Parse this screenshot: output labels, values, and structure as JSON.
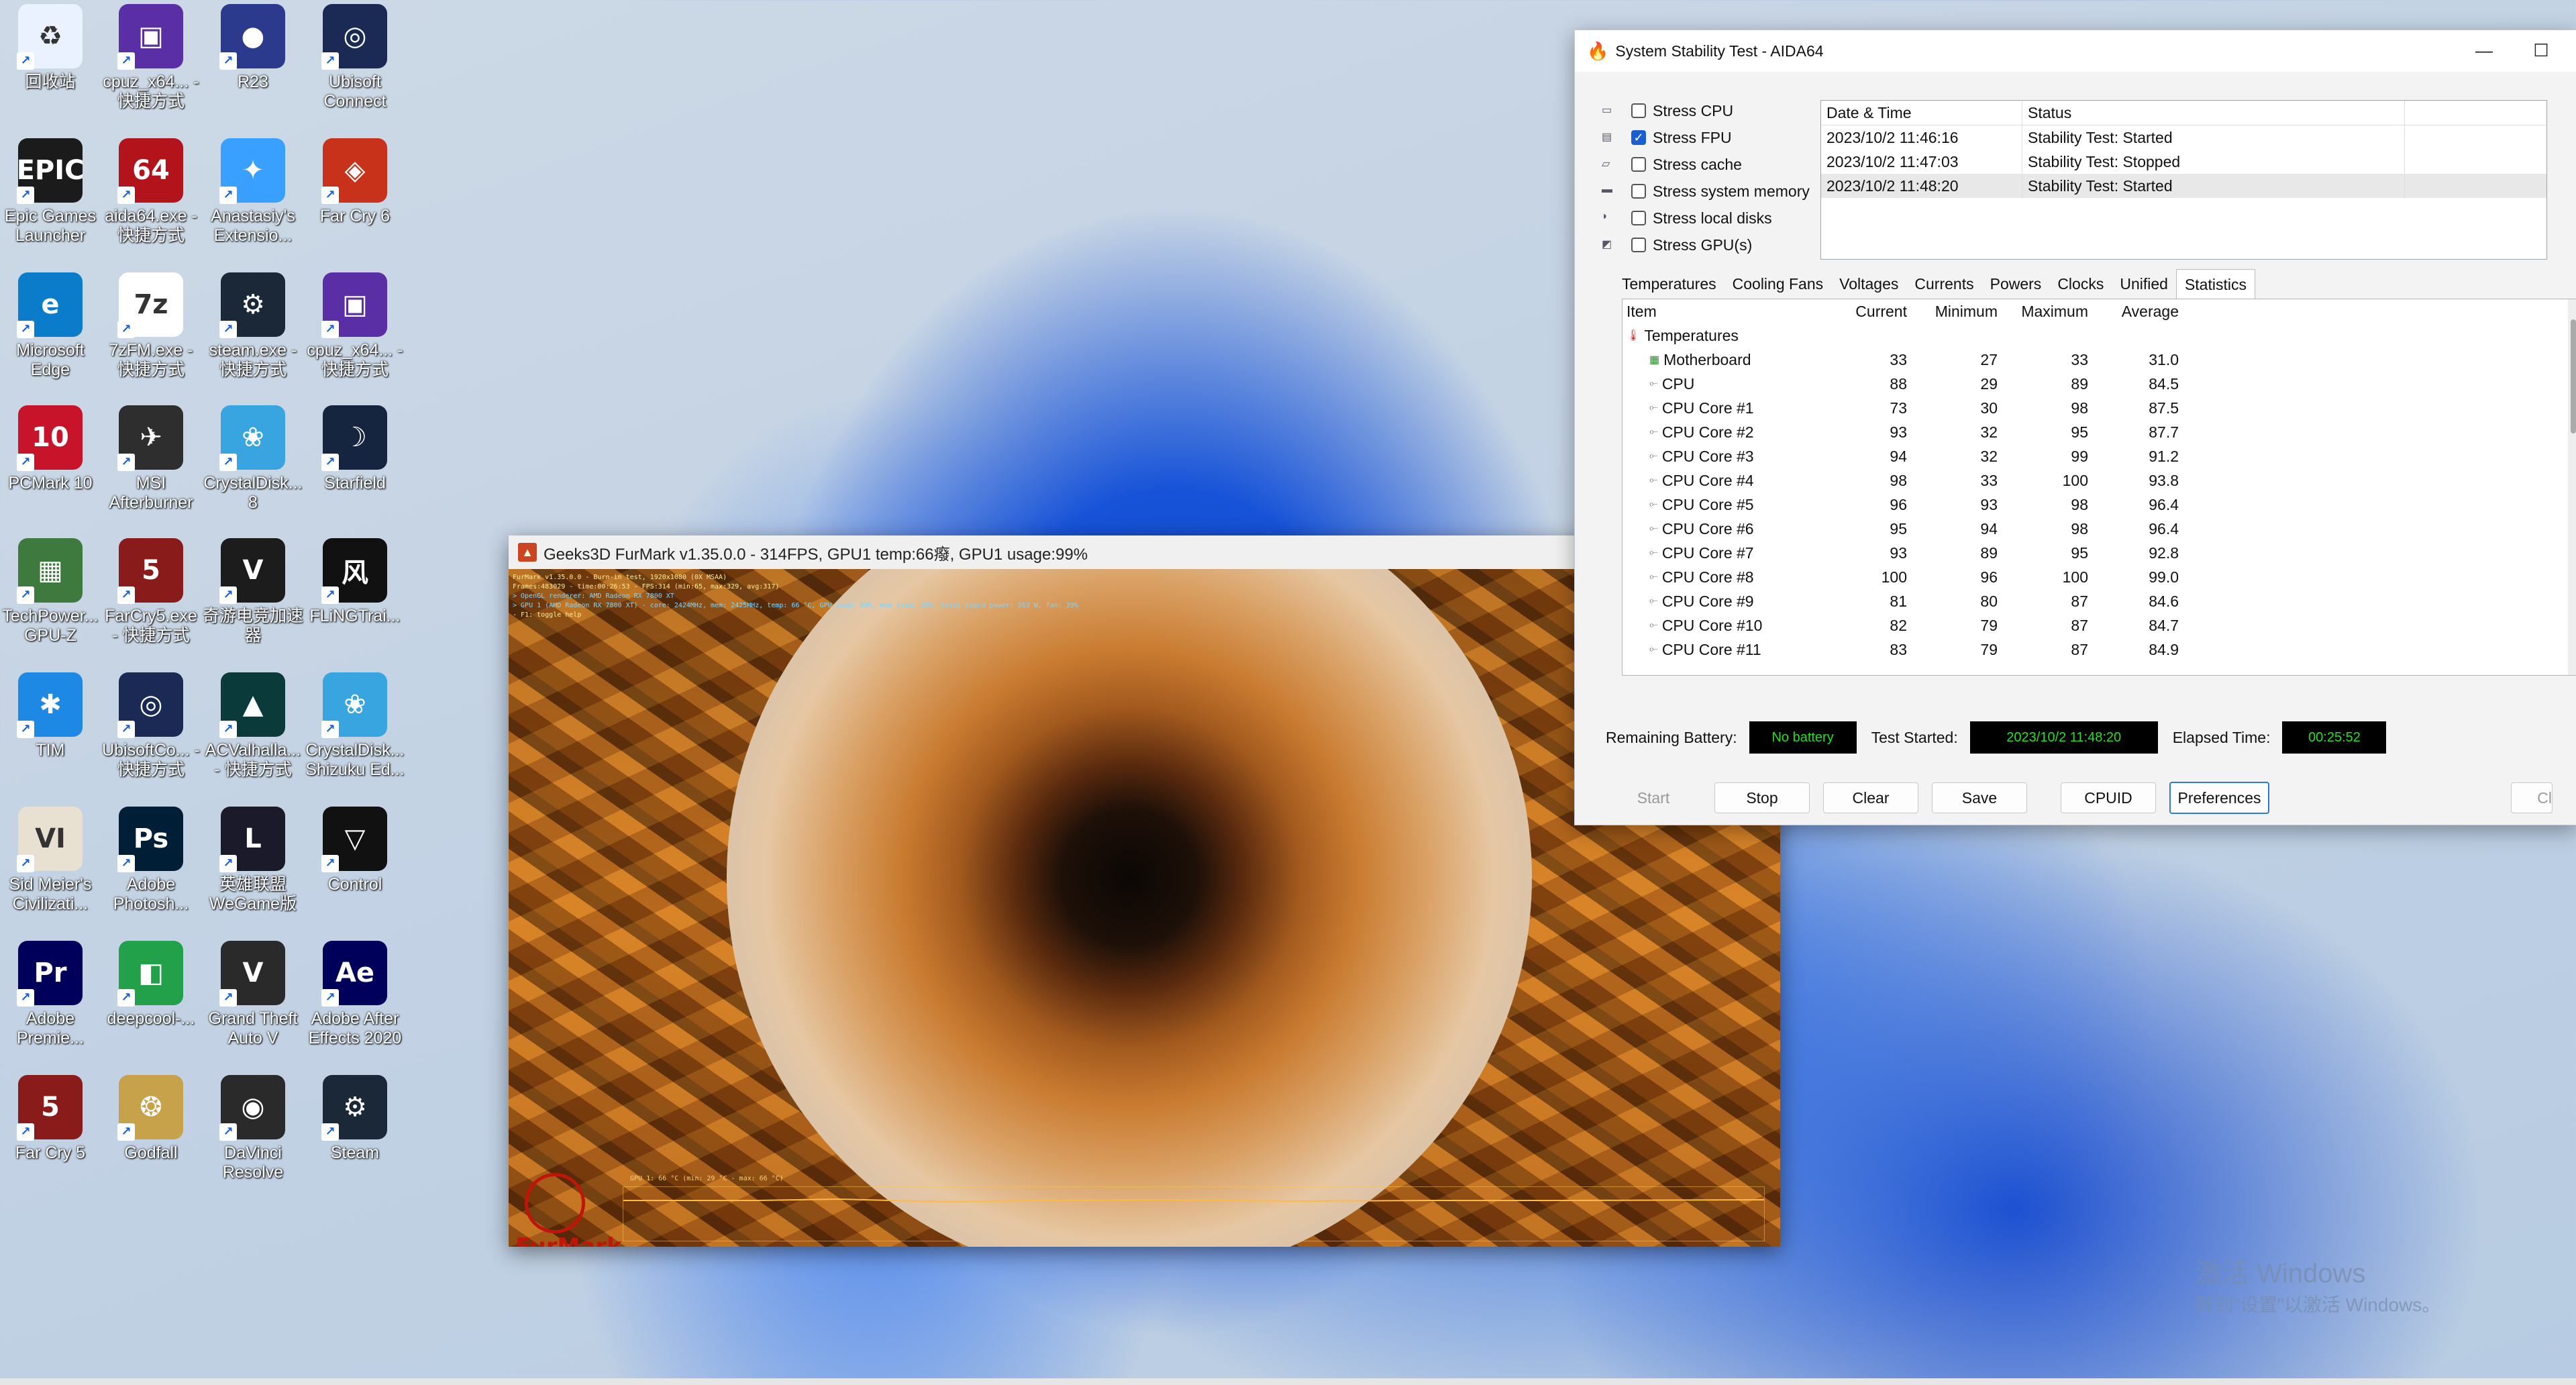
{
  "desktop_icons": [
    {
      "label": "回收站",
      "icon": "recycle-bin-icon",
      "bg": "#eaf2ff",
      "glyph": "♻"
    },
    {
      "label": "cpuz_x64... - 快捷方式",
      "icon": "cpuz-icon",
      "bg": "#5a2fa6",
      "glyph": "▣"
    },
    {
      "label": "R23",
      "icon": "cinebench-icon",
      "bg": "#2b3a8c",
      "glyph": "●"
    },
    {
      "label": "Ubisoft Connect",
      "icon": "ubisoft-icon",
      "bg": "#1b2a55",
      "glyph": "◎"
    },
    {
      "label": "Epic Games Launcher",
      "icon": "epic-games-icon",
      "bg": "#1b1b1b",
      "glyph": "EPIC"
    },
    {
      "label": "aida64.exe - 快捷方式",
      "icon": "aida64-icon",
      "bg": "#b3141c",
      "glyph": "64"
    },
    {
      "label": "Anastasiy's Extensio...",
      "icon": "anastasiy-icon",
      "bg": "#3aa0ff",
      "glyph": "✦"
    },
    {
      "label": "Far Cry 6",
      "icon": "farcry6-icon",
      "bg": "#c8321a",
      "glyph": "◈"
    },
    {
      "label": "Microsoft Edge",
      "icon": "edge-icon",
      "bg": "#0b7cc9",
      "glyph": "e"
    },
    {
      "label": "7zFM.exe - 快捷方式",
      "icon": "7zip-icon",
      "bg": "#ffffff",
      "glyph": "7z"
    },
    {
      "label": "steam.exe - 快捷方式",
      "icon": "steam-icon",
      "bg": "#1b2838",
      "glyph": "⚙"
    },
    {
      "label": "cpuz_x64... - 快捷方式",
      "icon": "cpuz-icon",
      "bg": "#5a2fa6",
      "glyph": "▣"
    },
    {
      "label": "PCMark 10",
      "icon": "pcmark-icon",
      "bg": "#c8142a",
      "glyph": "10"
    },
    {
      "label": "MSI Afterburner",
      "icon": "msi-afterburner-icon",
      "bg": "#2e2e2e",
      "glyph": "✈"
    },
    {
      "label": "CrystalDisk... 8",
      "icon": "crystaldisk-icon",
      "bg": "#38a4e0",
      "glyph": "❀"
    },
    {
      "label": "Starfield",
      "icon": "starfield-icon",
      "bg": "#16253f",
      "glyph": "☽"
    },
    {
      "label": "TechPower... GPU-Z",
      "icon": "gpuz-icon",
      "bg": "#3e7a3e",
      "glyph": "▦"
    },
    {
      "label": "FarCry5.exe - 快捷方式",
      "icon": "farcry5-icon",
      "bg": "#8a1b1b",
      "glyph": "5"
    },
    {
      "label": "奇游电竞加速器",
      "icon": "qiyou-icon",
      "bg": "#1c1c1c",
      "glyph": "V"
    },
    {
      "label": "FLiNGTrai...",
      "icon": "fling-icon",
      "bg": "#111111",
      "glyph": "风"
    },
    {
      "label": "TIM",
      "icon": "tim-icon",
      "bg": "#1e88e5",
      "glyph": "✱"
    },
    {
      "label": "UbisoftCo... - 快捷方式",
      "icon": "ubisoft-icon",
      "bg": "#1b2a55",
      "glyph": "◎"
    },
    {
      "label": "ACValhalla... - 快捷方式",
      "icon": "ac-valhalla-icon",
      "bg": "#0b3a3a",
      "glyph": "▲"
    },
    {
      "label": "CrystalDisk... Shizuku Ed...",
      "icon": "crystaldisk-icon",
      "bg": "#38a4e0",
      "glyph": "❀"
    },
    {
      "label": "Sid Meier's Civilizati...",
      "icon": "civilization-icon",
      "bg": "#e8e0d0",
      "glyph": "VI"
    },
    {
      "label": "Adobe Photosh...",
      "icon": "photoshop-icon",
      "bg": "#001e36",
      "glyph": "Ps"
    },
    {
      "label": "英雄联盟WeGame版",
      "icon": "lol-icon",
      "bg": "#1a1a2a",
      "glyph": "L"
    },
    {
      "label": "Control",
      "icon": "control-icon",
      "bg": "#111111",
      "glyph": "▽"
    },
    {
      "label": "Adobe Premie...",
      "icon": "premiere-icon",
      "bg": "#00005b",
      "glyph": "Pr"
    },
    {
      "label": "deepcool-...",
      "icon": "deepcool-icon",
      "bg": "#23a04a",
      "glyph": "◧"
    },
    {
      "label": "Grand Theft Auto V",
      "icon": "gta5-icon",
      "bg": "#2a2a2a",
      "glyph": "V"
    },
    {
      "label": "Adobe After Effects 2020",
      "icon": "after-effects-icon",
      "bg": "#00005b",
      "glyph": "Ae"
    },
    {
      "label": "Far Cry 5",
      "icon": "farcry5-icon",
      "bg": "#8a1b1b",
      "glyph": "5"
    },
    {
      "label": "Godfall",
      "icon": "godfall-icon",
      "bg": "#c8a24a",
      "glyph": "❂"
    },
    {
      "label": "DaVinci Resolve",
      "icon": "davinci-icon",
      "bg": "#2a2a2a",
      "glyph": "◉"
    },
    {
      "label": "Steam",
      "icon": "steam-icon",
      "bg": "#1b2838",
      "glyph": "⚙"
    }
  ],
  "aida": {
    "title": "System Stability Test - AIDA64",
    "minimize": "—",
    "maximize": "☐",
    "stress_options": [
      {
        "label": "Stress CPU",
        "checked": false,
        "icon": "cpu-icon"
      },
      {
        "label": "Stress FPU",
        "checked": true,
        "icon": "fpu-icon"
      },
      {
        "label": "Stress cache",
        "checked": false,
        "icon": "cache-icon"
      },
      {
        "label": "Stress system memory",
        "checked": false,
        "icon": "memory-icon"
      },
      {
        "label": "Stress local disks",
        "checked": false,
        "icon": "disk-icon"
      },
      {
        "label": "Stress GPU(s)",
        "checked": false,
        "icon": "gpu-icon"
      }
    ],
    "log_headers": {
      "date": "Date & Time",
      "status": "Status"
    },
    "log_rows": [
      {
        "date": "2023/10/2 11:46:16",
        "status": "Stability Test: Started"
      },
      {
        "date": "2023/10/2 11:47:03",
        "status": "Stability Test: Stopped"
      },
      {
        "date": "2023/10/2 11:48:20",
        "status": "Stability Test: Started"
      }
    ],
    "tabs": [
      "Temperatures",
      "Cooling Fans",
      "Voltages",
      "Currents",
      "Powers",
      "Clocks",
      "Unified",
      "Statistics"
    ],
    "active_tab": "Statistics",
    "stat_headers": {
      "item": "Item",
      "current": "Current",
      "minimum": "Minimum",
      "maximum": "Maximum",
      "average": "Average"
    },
    "stat_group": "Temperatures",
    "stat_rows": [
      {
        "item": "Motherboard",
        "current": "33",
        "minimum": "27",
        "maximum": "33",
        "average": "31.0"
      },
      {
        "item": "CPU",
        "current": "88",
        "minimum": "29",
        "maximum": "89",
        "average": "84.5"
      },
      {
        "item": "CPU Core #1",
        "current": "73",
        "minimum": "30",
        "maximum": "98",
        "average": "87.5"
      },
      {
        "item": "CPU Core #2",
        "current": "93",
        "minimum": "32",
        "maximum": "95",
        "average": "87.7"
      },
      {
        "item": "CPU Core #3",
        "current": "94",
        "minimum": "32",
        "maximum": "99",
        "average": "91.2"
      },
      {
        "item": "CPU Core #4",
        "current": "98",
        "minimum": "33",
        "maximum": "100",
        "average": "93.8"
      },
      {
        "item": "CPU Core #5",
        "current": "96",
        "minimum": "93",
        "maximum": "98",
        "average": "96.4"
      },
      {
        "item": "CPU Core #6",
        "current": "95",
        "minimum": "94",
        "maximum": "98",
        "average": "96.4"
      },
      {
        "item": "CPU Core #7",
        "current": "93",
        "minimum": "89",
        "maximum": "95",
        "average": "92.8"
      },
      {
        "item": "CPU Core #8",
        "current": "100",
        "minimum": "96",
        "maximum": "100",
        "average": "99.0"
      },
      {
        "item": "CPU Core #9",
        "current": "81",
        "minimum": "80",
        "maximum": "87",
        "average": "84.6"
      },
      {
        "item": "CPU Core #10",
        "current": "82",
        "minimum": "79",
        "maximum": "87",
        "average": "84.7"
      },
      {
        "item": "CPU Core #11",
        "current": "83",
        "minimum": "79",
        "maximum": "87",
        "average": "84.9"
      }
    ],
    "status": {
      "battery_label": "Remaining Battery:",
      "battery_value": "No battery",
      "started_label": "Test Started:",
      "started_value": "2023/10/2 11:48:20",
      "elapsed_label": "Elapsed Time:",
      "elapsed_value": "00:25:52"
    },
    "buttons": {
      "start": "Start",
      "stop": "Stop",
      "clear": "Clear",
      "save": "Save",
      "cpuid": "CPUID",
      "preferences": "Preferences",
      "close": "Cl"
    }
  },
  "furmark": {
    "title": "Geeks3D FurMark v1.35.0.0 - 314FPS, GPU1 temp:66癈, GPU1 usage:99%",
    "logo_text": "FurMark",
    "graph_label": "GPU 1: 66 °C (min: 29 °C - max: 66 °C)",
    "hud_lines": [
      "FurMark v1.35.0.0 - Burn-in test, 1920x1080 (0X MSAA)",
      "Frames:483029 - time:00:26:53 - FPS:314 (min:65, max:329, avg:317)",
      "> OpenGL renderer: AMD Radeon RX 7800 XT",
      "> GPU 1 (AMD Radeon RX 7800 XT) - core: 2424MHz, mem: 2425MHz, temp: 66 °C, GPU load: 99%, mem load: 58%, total board power: 263 W, fan: 39%",
      "- F1: toggle help"
    ]
  },
  "watermark": {
    "line1": "激活 Windows",
    "line2": "转到\"设置\"以激活 Windows。"
  }
}
